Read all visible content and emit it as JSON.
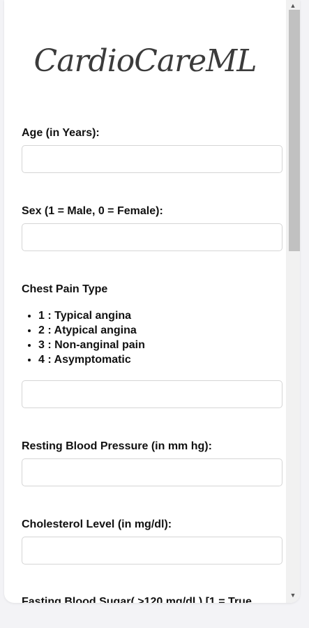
{
  "brand": {
    "logo_text": "CardioCareML"
  },
  "form": {
    "age_label": "Age (in Years):",
    "sex_label": "Sex (1 = Male, 0 = Female):",
    "chest_pain_label": "Chest Pain Type",
    "chest_pain_options": [
      "1 : Typical angina",
      "2 : Atypical angina",
      "3 : Non-anginal pain",
      "4 : Asymptomatic"
    ],
    "resting_bp_label": "Resting Blood Pressure (in mm hg):",
    "cholesterol_label": "Cholesterol Level (in mg/dl):",
    "fasting_sugar_label": "Fasting Blood Sugar( >120 mg/dl ) [1 = True"
  },
  "scrollbar": {
    "up_arrow": "▲",
    "down_arrow": "▼"
  }
}
